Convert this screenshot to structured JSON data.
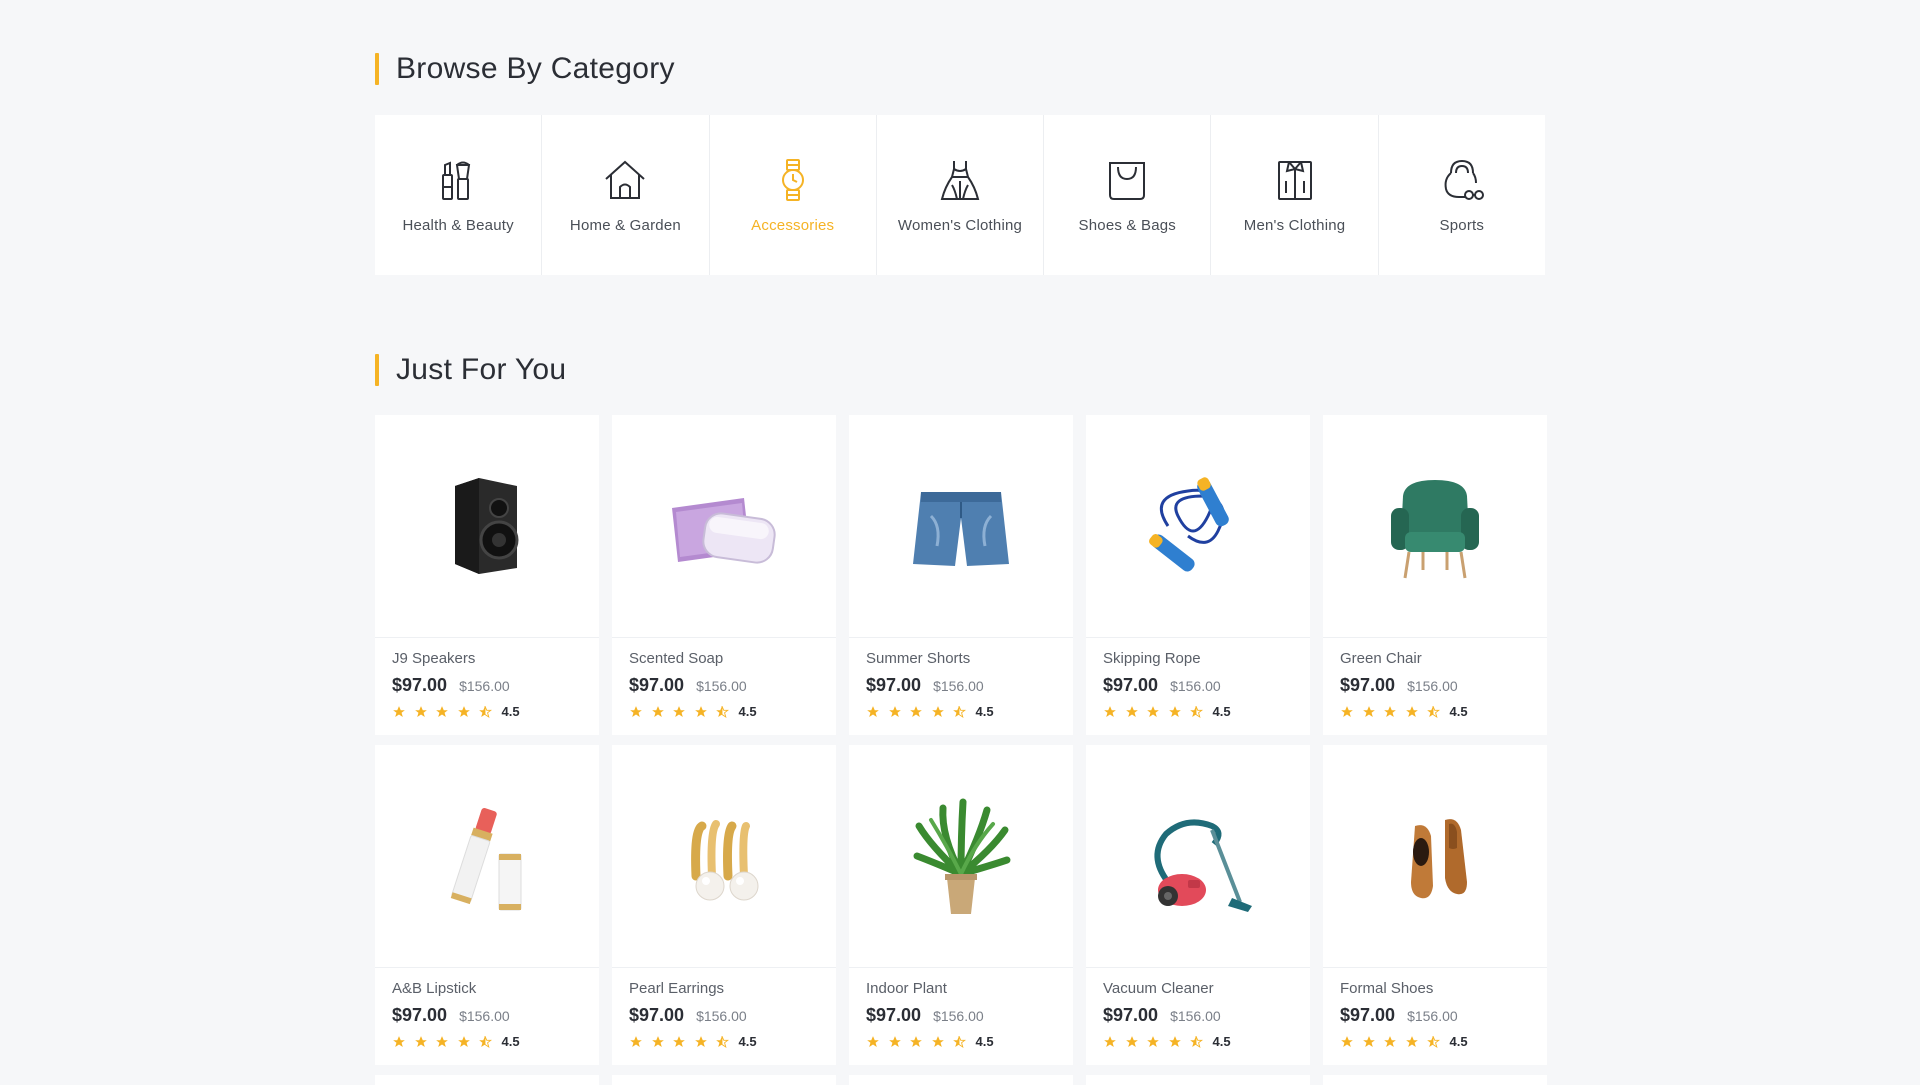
{
  "browse": {
    "title": "Browse By Category",
    "categories": [
      {
        "label": "Health & Beauty",
        "icon": "cosmetics-icon"
      },
      {
        "label": "Home & Garden",
        "icon": "house-icon"
      },
      {
        "label": "Accessories",
        "icon": "watch-icon",
        "active": true
      },
      {
        "label": "Women's Clothing",
        "icon": "dress-icon"
      },
      {
        "label": "Shoes & Bags",
        "icon": "shopping-bag-icon"
      },
      {
        "label": "Men's Clothing",
        "icon": "shirt-icon"
      },
      {
        "label": "Sports",
        "icon": "kettlebell-icon"
      }
    ]
  },
  "just_for_you": {
    "title": "Just For You",
    "products": [
      {
        "name": "J9 Speakers",
        "price": "$97.00",
        "old_price": "$156.00",
        "rating": "4.5",
        "icon": "speaker-icon"
      },
      {
        "name": "Scented Soap",
        "price": "$97.00",
        "old_price": "$156.00",
        "rating": "4.5",
        "icon": "soap-icon"
      },
      {
        "name": "Summer Shorts",
        "price": "$97.00",
        "old_price": "$156.00",
        "rating": "4.5",
        "icon": "shorts-icon"
      },
      {
        "name": "Skipping Rope",
        "price": "$97.00",
        "old_price": "$156.00",
        "rating": "4.5",
        "icon": "skipping-rope-icon"
      },
      {
        "name": "Green Chair",
        "price": "$97.00",
        "old_price": "$156.00",
        "rating": "4.5",
        "icon": "armchair-icon"
      },
      {
        "name": "A&B Lipstick",
        "price": "$97.00",
        "old_price": "$156.00",
        "rating": "4.5",
        "icon": "lipstick-icon"
      },
      {
        "name": "Pearl Earrings",
        "price": "$97.00",
        "old_price": "$156.00",
        "rating": "4.5",
        "icon": "earrings-icon"
      },
      {
        "name": "Indoor Plant",
        "price": "$97.00",
        "old_price": "$156.00",
        "rating": "4.5",
        "icon": "plant-icon"
      },
      {
        "name": "Vacuum Cleaner",
        "price": "$97.00",
        "old_price": "$156.00",
        "rating": "4.5",
        "icon": "vacuum-icon"
      },
      {
        "name": "Formal Shoes",
        "price": "$97.00",
        "old_price": "$156.00",
        "rating": "4.5",
        "icon": "shoes-icon"
      }
    ]
  },
  "colors": {
    "accent": "#f5b325",
    "text": "#2b2e35",
    "background": "#f6f7f9"
  }
}
